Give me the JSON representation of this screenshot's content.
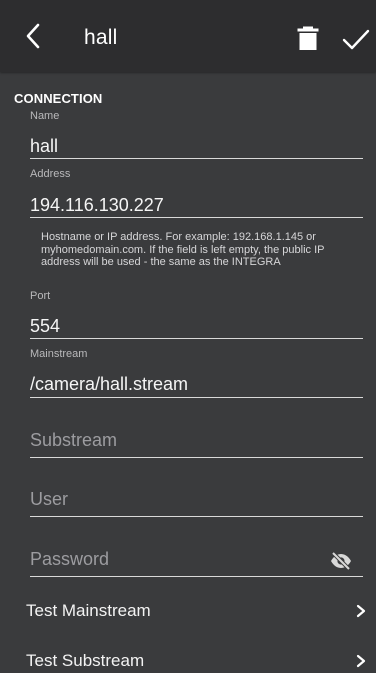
{
  "header": {
    "title": "hall"
  },
  "section": {
    "title": "CONNECTION"
  },
  "fields": {
    "name": {
      "label": "Name",
      "value": "hall"
    },
    "address": {
      "label": "Address",
      "value": "194.116.130.227",
      "helper": "Hostname or IP address. For example: 192.168.1.145 or myhomedomain.com. If the field is left empty, the public IP address will be used - the same as the INTEGRA"
    },
    "port": {
      "label": "Port",
      "value": "554"
    },
    "mainstream": {
      "label": "Mainstream",
      "value": "/camera/hall.stream"
    },
    "substream": {
      "placeholder": "Substream"
    },
    "user": {
      "placeholder": "User"
    },
    "password": {
      "placeholder": "Password"
    }
  },
  "actions": {
    "test_mainstream": "Test Mainstream",
    "test_substream": "Test Substream"
  },
  "icons": {
    "back": "back-arrow-icon",
    "delete": "trash-icon",
    "confirm": "checkmark-icon",
    "password_toggle": "eye-off-icon",
    "chevron": "chevron-right-icon"
  },
  "colors": {
    "app_bar": "#2d2d2f",
    "background": "#3a3b3d",
    "text": "#f1f1f1",
    "underline": "#d9d9d9"
  }
}
